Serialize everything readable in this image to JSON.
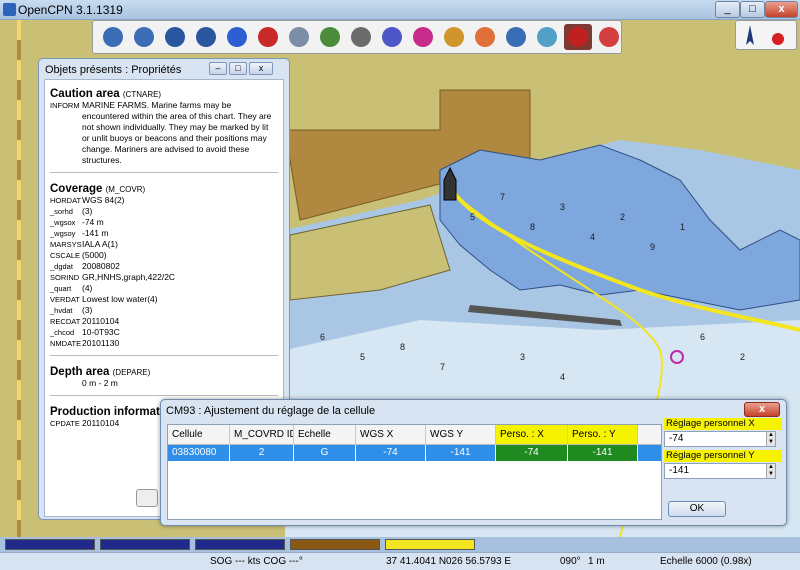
{
  "window": {
    "title": "OpenCPN 3.1.1319",
    "close_label": "x"
  },
  "toolbar": {
    "tools": [
      {
        "name": "zoom-in-icon",
        "color": "#3a6db5"
      },
      {
        "name": "zoom-out-icon",
        "color": "#3a6db5"
      },
      {
        "name": "scale-in-icon",
        "color": "#2a56a0"
      },
      {
        "name": "scale-out-icon",
        "color": "#2a56a0"
      },
      {
        "name": "route-icon",
        "color": "#2d5fd3"
      },
      {
        "name": "ship-follow-icon",
        "color": "#c82a2a"
      },
      {
        "name": "settings-wrench-icon",
        "color": "#7c8da6"
      },
      {
        "name": "text-icon",
        "color": "#4b8c3a"
      },
      {
        "name": "print-icon",
        "color": "#6b6b6b"
      },
      {
        "name": "route-manager-icon",
        "color": "#4e56c8"
      },
      {
        "name": "track-icon",
        "color": "#c72b8b"
      },
      {
        "name": "color-scheme-icon",
        "color": "#d1962b"
      },
      {
        "name": "mob-lifering-icon",
        "color": "#e0703a"
      },
      {
        "name": "help-icon",
        "color": "#3a6db5"
      },
      {
        "name": "plugin-icon",
        "color": "#52a0c8"
      },
      {
        "name": "tide-current-icon",
        "color": "#c12020"
      },
      {
        "name": "marine-farm-icon",
        "color": "#d33f3f"
      }
    ],
    "active_index": 15
  },
  "properties_window": {
    "title": "Objets présents : Propriétés",
    "objects": [
      {
        "name": "Caution area",
        "code": "(CTNARE)",
        "attributes": [
          {
            "key": "INFORM",
            "value": "MARINE FARMS. Marine farms may be encountered within the area of this chart. They are not shown individually. They may be marked by lit or unlit buoys or beacons and their positions may change. Mariners are advised to avoid these structures."
          }
        ]
      },
      {
        "name": "Coverage",
        "code": "(M_COVR)",
        "attributes": [
          {
            "key": "HORDAT",
            "value": "WGS 84(2)"
          },
          {
            "key": "_sorhd",
            "value": "(3)"
          },
          {
            "key": "_wgsox",
            "value": "-74 m"
          },
          {
            "key": "_wgsoy",
            "value": "-141 m"
          },
          {
            "key": "MARSYS",
            "value": "IALA A(1)"
          },
          {
            "key": "CSCALE",
            "value": "(5000)"
          },
          {
            "key": "_dgdat",
            "value": "20080802"
          },
          {
            "key": "SORIND",
            "value": "GR,HNHS,graph,422/2C"
          },
          {
            "key": "_quart",
            "value": "(4)"
          },
          {
            "key": "VERDAT",
            "value": "Lowest low water(4)"
          },
          {
            "key": "_hvdat",
            "value": "(3)"
          },
          {
            "key": "RECDAT",
            "value": "20110104"
          },
          {
            "key": "_chcod",
            "value": "10-0T93C"
          },
          {
            "key": "NMDATE",
            "value": "20101130"
          }
        ]
      },
      {
        "name": "Depth area",
        "code": "(DEPARE)",
        "attributes": [
          {
            "key": "",
            "value": "0 m - 2 m"
          }
        ]
      },
      {
        "name": "Production informatio",
        "code": "",
        "attributes": [
          {
            "key": "CPDATE",
            "value": "20110104"
          }
        ]
      }
    ]
  },
  "cm93_dialog": {
    "title": "CM93 : Ajustement du réglage de la cellule",
    "close_label": "x",
    "columns": [
      "Cellule",
      "M_COVRD ID",
      "Echelle",
      "WGS X",
      "WGS Y",
      "Perso. : X",
      "Perso. : Y"
    ],
    "rows": [
      [
        "03830080",
        "2",
        "G",
        "-74",
        "-141",
        "-74",
        "-141"
      ]
    ],
    "x_label": "Réglage personnel X (mètres)",
    "x_value": "-74",
    "y_label": "Réglage personnel Y (mètres)",
    "y_value": "-141",
    "ok_label": "OK"
  },
  "color_bar": [
    "#1f2a8a",
    "#1f2a8a",
    "#1f2a8a",
    "#8a5a14",
    "#f3e51f"
  ],
  "status": {
    "sog_cog": "SOG --- kts  COG ---°",
    "lat": "37 41.4041 N",
    "lon": "026 56.5793 E",
    "bearing": "090°",
    "distance": "1 m",
    "scale": "Echelle 6000 (0.98x)"
  },
  "chart_depths": [
    "5",
    "7",
    "8",
    "3",
    "4",
    "2",
    "9",
    "1",
    "6",
    "5",
    "8",
    "7",
    "3",
    "4",
    "6",
    "2"
  ]
}
